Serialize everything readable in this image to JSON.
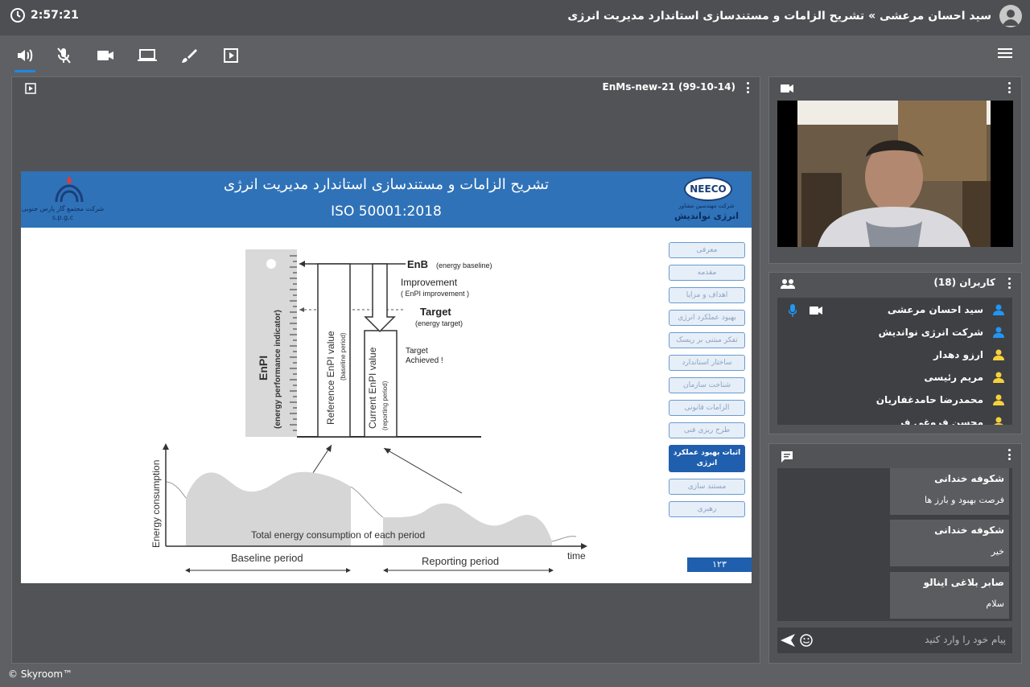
{
  "topbar": {
    "time": "2:57:21",
    "title": "سید احسان مرعشی » تشریح الزامات و مستندسازی استاندارد مدیریت انرژی"
  },
  "presentation": {
    "file_name": "EnMs-new-21 (99-10-14)",
    "slide": {
      "title_fa": "تشریح الزامات و مستندسازی استاندارد مدیریت انرژی",
      "title_iso": "ISO 50001:2018",
      "left_logo_text": "شرکت مجتمع گاز پارس جنوبی",
      "left_logo_sub": "s.p.g.c",
      "right_logo": "NEECO",
      "right_logo_sub": "شرکت مهندسین مشاور",
      "right_logo_name": "انرژی نواندیش",
      "page_number": "۱۲۳",
      "menu": [
        "معرفی",
        "مقدمه",
        "اهداف و مزایا",
        "بهبود عملکرد انرژی",
        "تفکر مبتنی بر ریسک",
        "ساختار استاندارد",
        "شناخت سازمان",
        "الزامات قانونی",
        "طرح ریزی فنی",
        "اثبات بهبود عملکرد انرژی",
        "مستند سازی",
        "رهبری"
      ],
      "active_menu_index": 9,
      "diagram": {
        "enb": "EnB",
        "enb_sub": "(energy baseline)",
        "improvement": "Improvement",
        "improvement_sub": "( EnPI improvement )",
        "target": "Target",
        "target_sub": "(energy target)",
        "target_achieved_1": "Target",
        "target_achieved_2": "Achieved !",
        "enpi": "EnPI",
        "enpi_sub": "(energy performance indicator)",
        "reference": "Reference EnPI value",
        "reference_sub": "(baseline period)",
        "current": "Current EnPI value",
        "current_sub": "(reporting period)",
        "energy_axis": "Energy consumption",
        "total": "Total energy consumption of each period",
        "time": "time",
        "baseline_period": "Baseline period",
        "reporting_period": "Reporting period"
      }
    }
  },
  "users": {
    "header": "کاربران (18)",
    "list": [
      {
        "name": "سید احسان مرعشی",
        "color": "#2196f3",
        "mic": true,
        "cam": true
      },
      {
        "name": "شرکت انرژی نواندیش",
        "color": "#2196f3",
        "mic": false,
        "cam": false
      },
      {
        "name": "ارزو دهدار",
        "color": "#f6d13c",
        "mic": false,
        "cam": false
      },
      {
        "name": "مریم رئیسی",
        "color": "#f6d13c",
        "mic": false,
        "cam": false
      },
      {
        "name": "محمدرضا حامدغفاریان",
        "color": "#f6d13c",
        "mic": false,
        "cam": false
      },
      {
        "name": "محسن فروغی فر",
        "color": "#f6d13c",
        "mic": false,
        "cam": false
      }
    ]
  },
  "chat": {
    "messages": [
      {
        "sender": "شکوفه خندانی",
        "text": "فرصت بهبود و بارز ها"
      },
      {
        "sender": "شکوفه خندانی",
        "text": "خیر"
      },
      {
        "sender": "صابر بلاغی اینالو",
        "text": "سلام"
      }
    ],
    "placeholder": "پیام خود را وارد کنید"
  },
  "footer": "© Skyroom™"
}
